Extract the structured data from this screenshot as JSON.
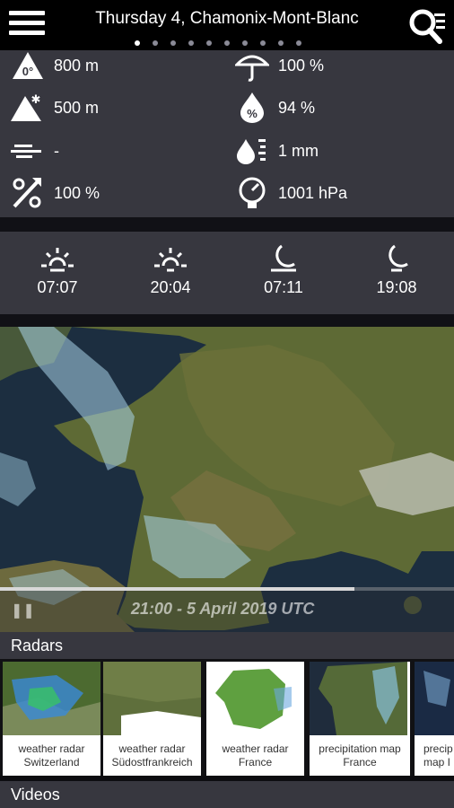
{
  "header": {
    "title": "Thursday 4, Chamonix-Mont-Blanc",
    "page_dots": 10,
    "active_dot": 0
  },
  "stats": {
    "freezing_level": "800 m",
    "snow_limit": "500 m",
    "wind": "-",
    "probability": "100 %",
    "rain_probability": "100 %",
    "humidity": "94 %",
    "precipitation": "1 mm",
    "pressure": "1001 hPa"
  },
  "sun": {
    "sunrise": "07:07",
    "sunset": "20:04",
    "moonrise": "07:11",
    "moonset": "19:08"
  },
  "map": {
    "timestamp": "21:00 - 5 April 2019 UTC",
    "progress": 0.78
  },
  "radars": {
    "title": "Radars",
    "items": [
      {
        "line1": "weather radar",
        "line2": "Switzerland"
      },
      {
        "line1": "weather radar",
        "line2": "Südostfrankreich"
      },
      {
        "line1": "weather radar",
        "line2": "France"
      },
      {
        "line1": "precipitation map",
        "line2": "France"
      },
      {
        "line1": "precip",
        "line2": "map I"
      }
    ]
  },
  "videos": {
    "title": "Videos"
  },
  "colors": {
    "panel": "#37373f",
    "background": "#111116",
    "accent": "#ffffff"
  }
}
